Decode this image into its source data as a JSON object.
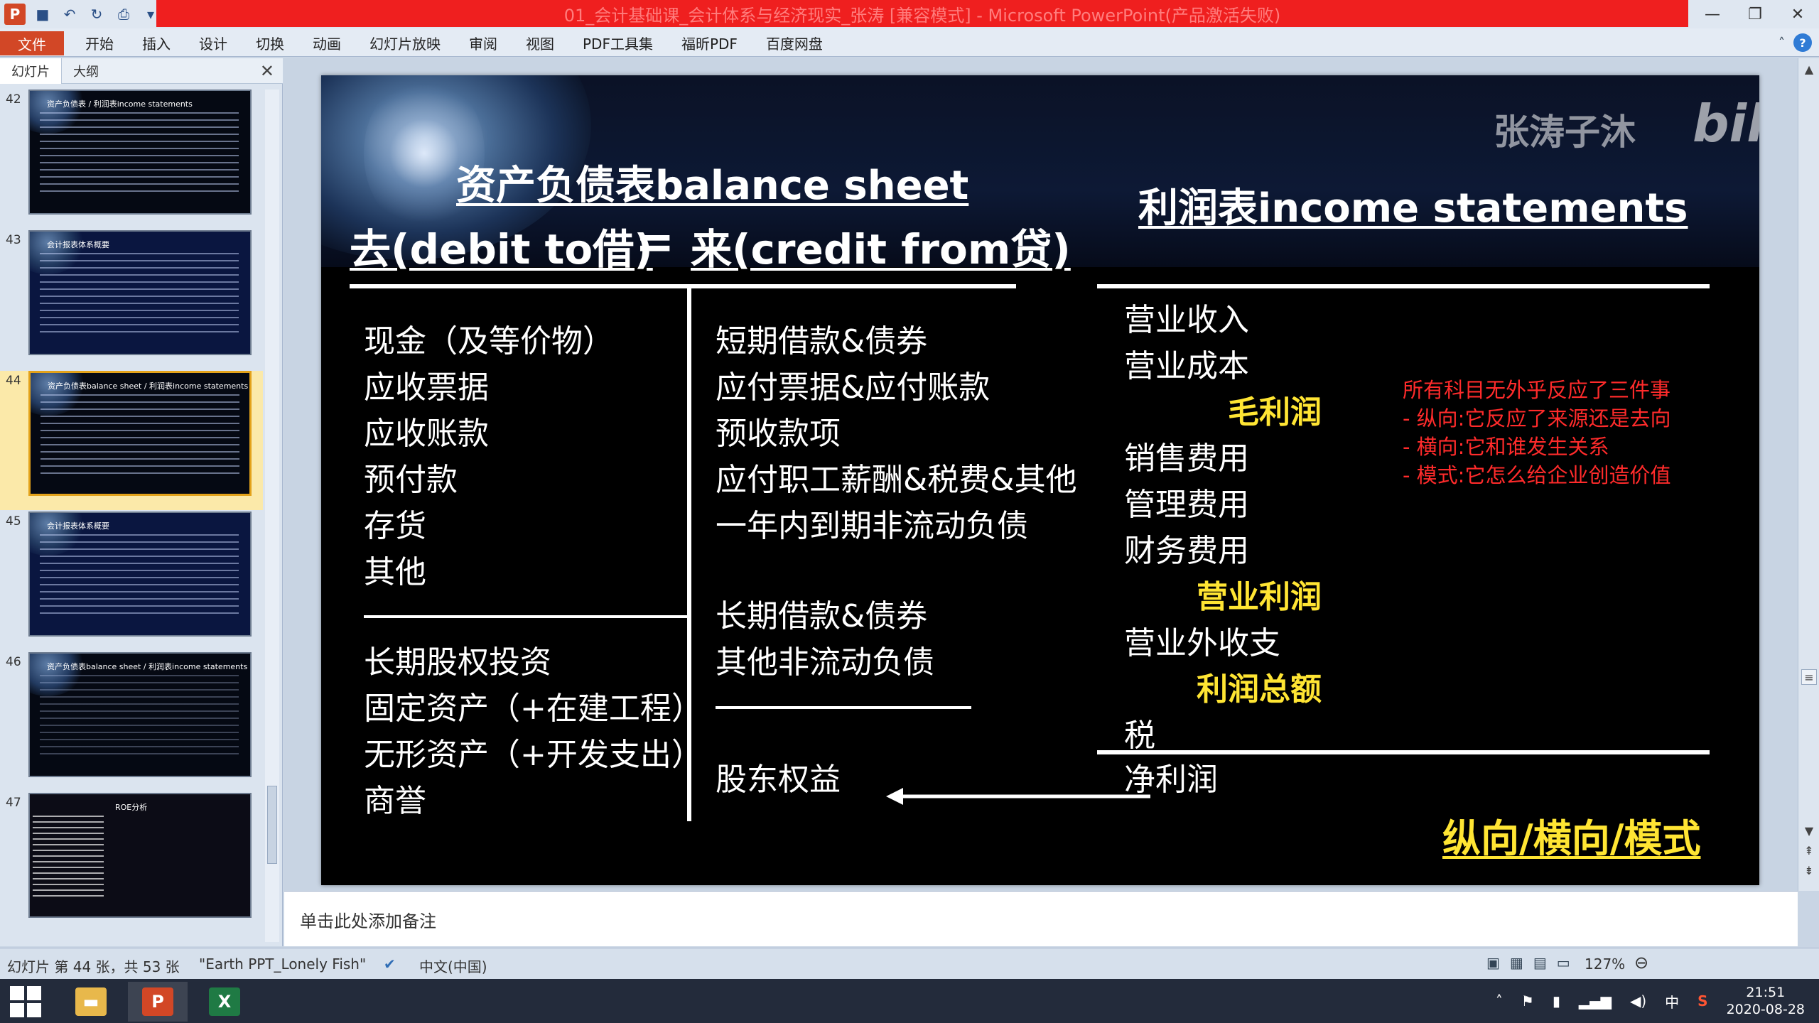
{
  "window": {
    "title": "01_会计基础课_会计体系与经济现实_张涛 [兼容模式] - Microsoft PowerPoint(产品激活失败)",
    "controls": [
      "—",
      "❐",
      "✕"
    ]
  },
  "ribbon": {
    "file_tab": "文件",
    "tabs": [
      "开始",
      "插入",
      "设计",
      "切换",
      "动画",
      "幻灯片放映",
      "审阅",
      "视图",
      "PDF工具集",
      "福昕PDF",
      "百度网盘"
    ]
  },
  "slide_pane": {
    "tabs": [
      "幻灯片",
      "大纲"
    ],
    "close": "✕",
    "thumbnails": [
      {
        "num": "42",
        "caption": "资产负债表 / 利润表income statements"
      },
      {
        "num": "43",
        "caption": "会计报表体系概要"
      },
      {
        "num": "44",
        "caption": "资产负债表balance sheet / 利润表income statements",
        "selected": true
      },
      {
        "num": "45",
        "caption": "会计报表体系概要"
      },
      {
        "num": "46",
        "caption": "资产负债表balance sheet / 利润表income statements"
      },
      {
        "num": "47",
        "caption": "ROE分析"
      }
    ]
  },
  "slide": {
    "bs_title": "资产负债表balance sheet",
    "debit": "去(debit to借)",
    "equals": "=",
    "credit": "来(credit from贷)",
    "is_title": "利润表income statements",
    "assets_current": [
      "现金（及等价物）",
      "应收票据",
      "应收账款",
      "预付款",
      "存货",
      "其他"
    ],
    "assets_noncurrent": [
      "长期股权投资",
      "固定资产（+在建工程）",
      "无形资产（+开发支出）",
      "商誉"
    ],
    "liab_current": [
      "短期借款&债券",
      "应付票据&应付账款",
      "预收款项",
      "应付职工薪酬&税费&其他",
      "一年内到期非流动负债"
    ],
    "liab_noncurrent": [
      "长期借款&债券",
      "其他非流动负债"
    ],
    "equity": "股东权益",
    "income": {
      "revenue": "营业收入",
      "cost": "营业成本",
      "gross_profit": "毛利润",
      "selling": "销售费用",
      "admin": "管理费用",
      "finance": "财务费用",
      "operating_profit": "营业利润",
      "non_operating": "营业外收支",
      "total_profit": "利润总额",
      "tax": "税",
      "net_profit": "净利润"
    },
    "notes": [
      "所有科目无外乎反应了三件事",
      "- 纵向:它反应了来源还是去向",
      "- 横向:它和谁发生关系",
      "- 模式:它怎么给企业创造价值"
    ],
    "summary": "纵向/横向/模式",
    "watermark": "张涛子沐",
    "watermark_logo": "bilibili"
  },
  "notes_pane": {
    "placeholder": "单击此处添加备注"
  },
  "status": {
    "slide_info": "幻灯片 第 44 张，共 53 张",
    "theme": "\"Earth PPT_Lonely Fish\"",
    "language": "中文(中国)",
    "zoom": "127%"
  },
  "taskbar": {
    "time": "21:51",
    "date": "2020-08-28",
    "ime": "中"
  },
  "colors": {
    "title_bar_red": "#ef1f1f",
    "file_tab": "#d24726",
    "highlight_yellow": "#ffe533",
    "note_red": "#ff2b2b"
  }
}
